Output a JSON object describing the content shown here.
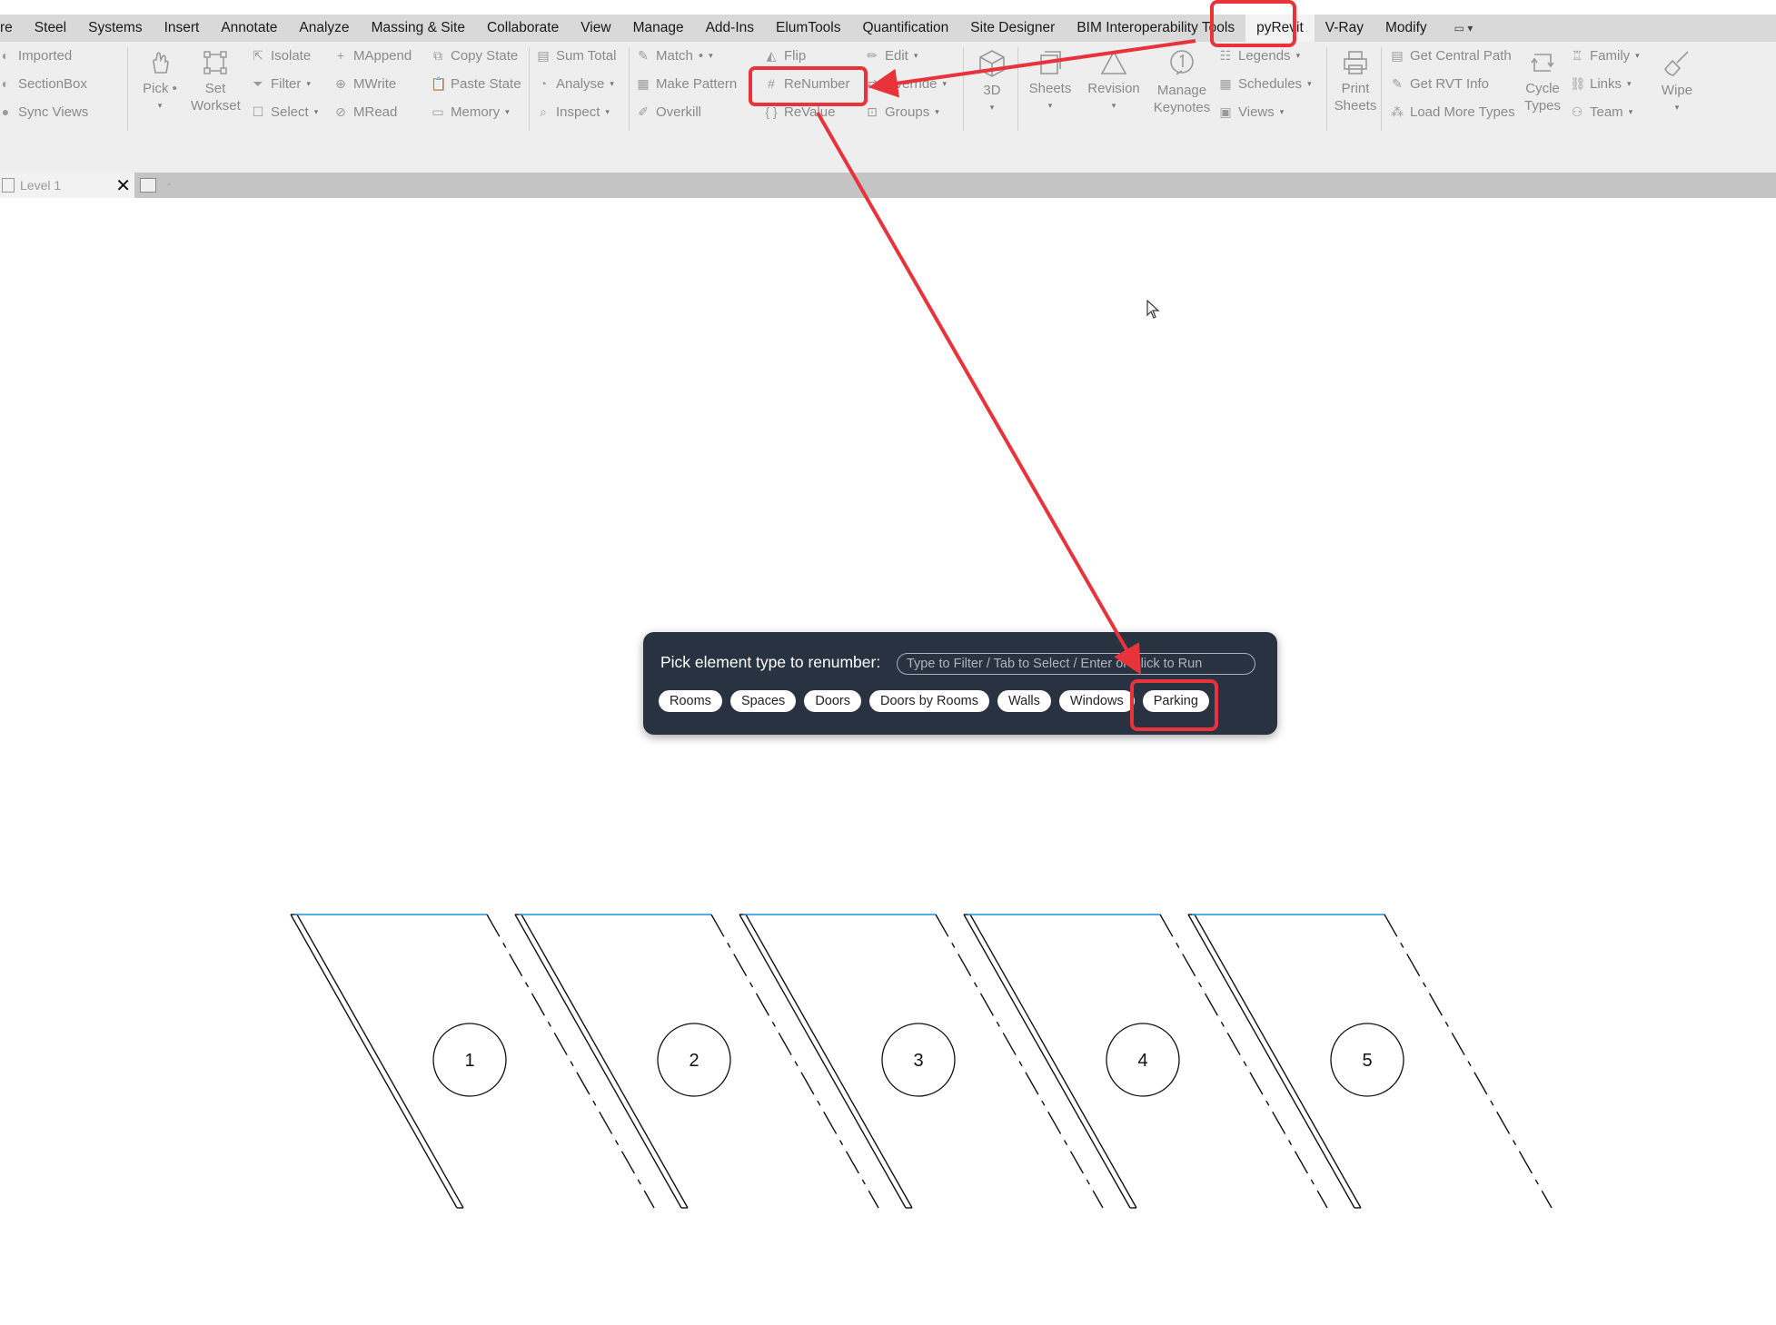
{
  "tabs": [
    {
      "label": "re"
    },
    {
      "label": "Steel"
    },
    {
      "label": "Systems"
    },
    {
      "label": "Insert"
    },
    {
      "label": "Annotate"
    },
    {
      "label": "Analyze"
    },
    {
      "label": "Massing & Site"
    },
    {
      "label": "Collaborate"
    },
    {
      "label": "View"
    },
    {
      "label": "Manage"
    },
    {
      "label": "Add-Ins"
    },
    {
      "label": "ElumTools"
    },
    {
      "label": "Quantification"
    },
    {
      "label": "Site Designer"
    },
    {
      "label": "BIM Interoperability Tools"
    },
    {
      "label": "pyRevit",
      "active": true
    },
    {
      "label": "V-Ray"
    },
    {
      "label": "Modify"
    }
  ],
  "ribbon": {
    "imported": "Imported",
    "sectionbox": "SectionBox",
    "sync_views": "Sync Views",
    "pick": "Pick",
    "set_workset_1": "Set",
    "set_workset_2": "Workset",
    "isolate": "Isolate",
    "filter": "Filter",
    "select": "Select",
    "mappend": "MAppend",
    "mwrite": "MWrite",
    "mread": "MRead",
    "copy_state": "Copy State",
    "paste_state": "Paste State",
    "memory": "Memory",
    "sum_total": "Sum Total",
    "analyse": "Analyse",
    "inspect": "Inspect",
    "match": "Match",
    "make_pattern": "Make Pattern",
    "overkill": "Overkill",
    "flip": "Flip",
    "renumber": "ReNumber",
    "revalue": "ReValue",
    "edit": "Edit",
    "override": "Override",
    "groups": "Groups",
    "three_d": "3D",
    "sheets": "Sheets",
    "revision": "Revision",
    "manage_keynotes_1": "Manage",
    "manage_keynotes_2": "Keynotes",
    "legends": "Legends",
    "schedules": "Schedules",
    "views": "Views",
    "print_sheets_1": "Print",
    "print_sheets_2": "Sheets",
    "get_central_path": "Get Central Path",
    "get_rvt_info": "Get RVT Info",
    "load_more_types": "Load More Types",
    "cycle_types_1": "Cycle",
    "cycle_types_2": "Types",
    "family": "Family",
    "links": "Links",
    "team": "Team",
    "wipe": "Wipe"
  },
  "view_tab": {
    "label": "Level 1",
    "close": "✕",
    "extra": "-"
  },
  "dialog": {
    "label": "Pick element type to renumber:",
    "placeholder": "Type to Filter / Tab to Select / Enter or Click to Run",
    "options": [
      "Rooms",
      "Spaces",
      "Doors",
      "Doors by Rooms",
      "Walls",
      "Windows",
      "Parking"
    ]
  },
  "parking_numbers": [
    "1",
    "2",
    "3",
    "4",
    "5"
  ],
  "colors": {
    "highlight": "#e8333b",
    "dialog_bg": "#293241",
    "tab_active": "#f3f3f3",
    "edge_blue": "#1e90e0"
  }
}
